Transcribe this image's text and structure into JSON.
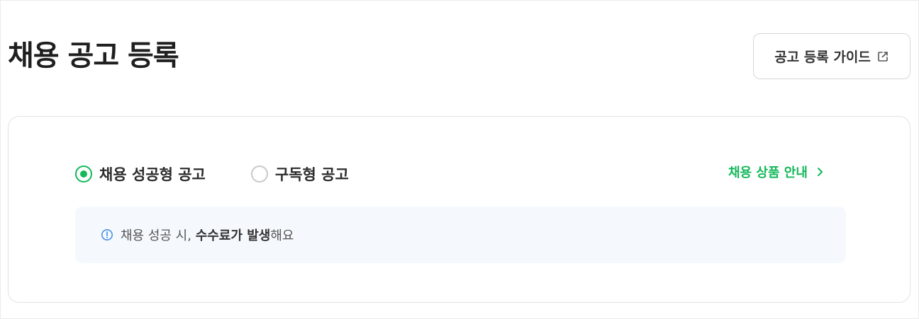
{
  "header": {
    "title": "채용 공고 등록",
    "guide_button_label": "공고 등록 가이드"
  },
  "card": {
    "options": [
      {
        "label": "채용 성공형 공고",
        "selected": true
      },
      {
        "label": "구독형 공고",
        "selected": false
      }
    ],
    "product_link_label": "채용 상품 안내",
    "notice": {
      "prefix": "채용 성공 시, ",
      "emphasis": "수수료가 발생",
      "suffix": "해요"
    }
  },
  "colors": {
    "accent": "#14b85a",
    "notice_bg": "#f5f9fd",
    "info_icon": "#4a90e2"
  },
  "icons": {
    "guide": "external-link-icon",
    "link": "chevron-right-icon",
    "notice": "info-circle-icon"
  }
}
